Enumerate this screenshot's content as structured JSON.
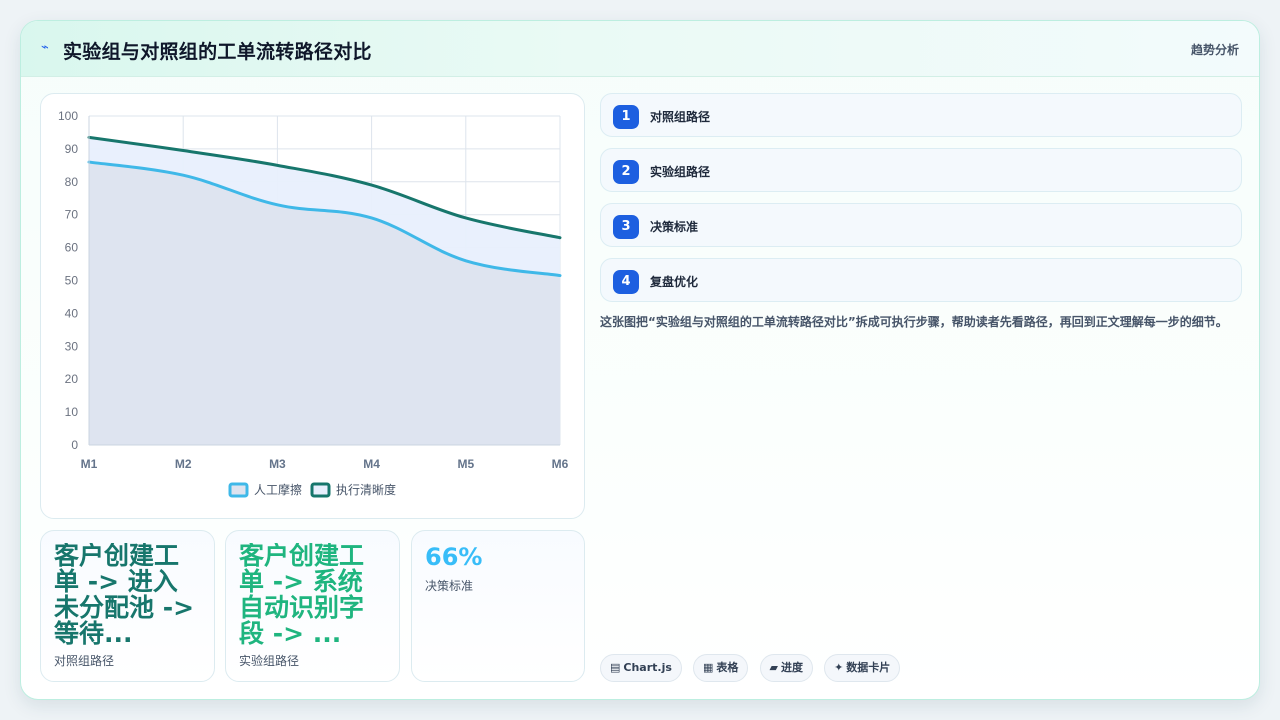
{
  "header": {
    "logo_icon": "pulse-icon",
    "title": "实验组与对照组的工单流转路径对比",
    "tag": "趋势分析"
  },
  "chart_data": {
    "type": "area",
    "categories": [
      "M1",
      "M2",
      "M3",
      "M4",
      "M5",
      "M6"
    ],
    "ylim": [
      0,
      100
    ],
    "yticks": [
      0,
      10,
      20,
      30,
      40,
      50,
      60,
      70,
      80,
      90,
      100
    ],
    "grid": true,
    "legend_position": "bottom",
    "series": [
      {
        "name": "人工摩擦",
        "values": [
          86,
          82,
          73,
          69,
          56,
          51.5
        ],
        "color": "#3fb8e8",
        "fill": "#dde3ef"
      },
      {
        "name": "执行清晰度",
        "values": [
          93.5,
          89.5,
          85,
          79,
          69,
          63
        ],
        "color": "#17766c",
        "fill": "#e8effd"
      }
    ]
  },
  "stats": [
    {
      "value": "客户创建工单 -> 进入未分配池 -> 等待...",
      "label": "对照组路径",
      "color": "#17766c"
    },
    {
      "value": "客户创建工单 -> 系统自动识别字段 -> ...",
      "label": "实验组路径",
      "color": "#1fb57f"
    },
    {
      "value": "66%",
      "label": "决策标准",
      "color": "#38bdf8"
    }
  ],
  "steps": [
    {
      "num": "1",
      "label": "对照组路径"
    },
    {
      "num": "2",
      "label": "实验组路径"
    },
    {
      "num": "3",
      "label": "决策标准"
    },
    {
      "num": "4",
      "label": "复盘优化"
    }
  ],
  "description": "这张图把“实验组与对照组的工单流转路径对比”拆成可执行步骤，帮助读者先看路径，再回到正文理解每一步的细节。",
  "chips": [
    {
      "icon": "▤",
      "label": "Chart.js"
    },
    {
      "icon": "▦",
      "label": "表格"
    },
    {
      "icon": "▰",
      "label": "进度"
    },
    {
      "icon": "✦",
      "label": "数据卡片"
    }
  ]
}
